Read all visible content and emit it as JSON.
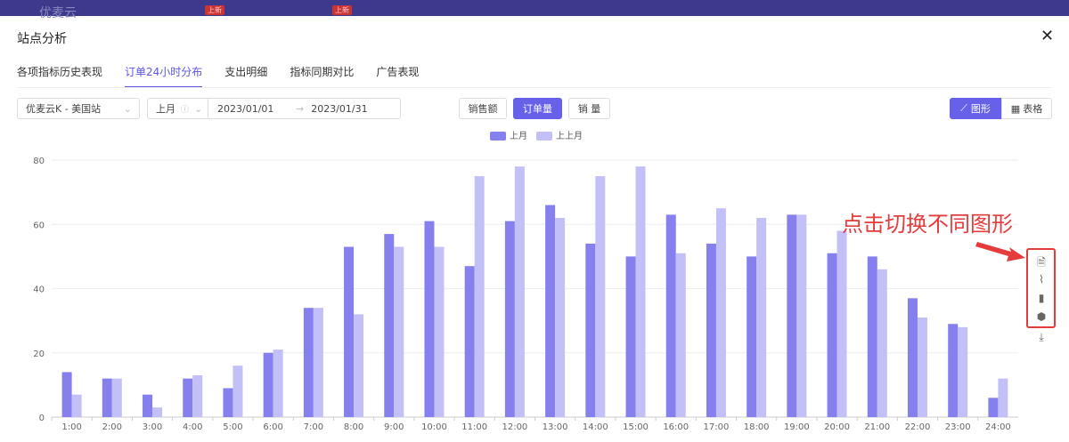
{
  "topbar": {
    "logo": "优麦云",
    "badges": [
      "上新",
      "上新"
    ]
  },
  "modal": {
    "title": "站点分析"
  },
  "tabs": [
    {
      "label": "各项指标历史表现"
    },
    {
      "label": "订单24小时分布",
      "active": true
    },
    {
      "label": "支出明细"
    },
    {
      "label": "指标同期对比"
    },
    {
      "label": "广告表现"
    }
  ],
  "filters": {
    "store": "优麦云K - 美国站",
    "period": "上月",
    "start": "2023/01/01",
    "arrow": "→",
    "end": "2023/01/31"
  },
  "metrics": [
    {
      "label": "销售额"
    },
    {
      "label": "订单量",
      "active": true
    },
    {
      "label": "销 量"
    }
  ],
  "view": {
    "chart_label": "图形",
    "table_label": "表格"
  },
  "annotation": "点击切换不同图形",
  "colors": {
    "accent": "#6760e8",
    "series1": "#8680ee",
    "series2": "#c3c0f8",
    "annotation": "#e53b3b"
  },
  "chart_data": {
    "type": "bar",
    "categories": [
      "1:00",
      "2:00",
      "3:00",
      "4:00",
      "5:00",
      "6:00",
      "7:00",
      "8:00",
      "9:00",
      "10:00",
      "11:00",
      "12:00",
      "13:00",
      "14:00",
      "15:00",
      "16:00",
      "17:00",
      "18:00",
      "19:00",
      "20:00",
      "21:00",
      "22:00",
      "23:00",
      "24:00"
    ],
    "series": [
      {
        "name": "上月",
        "values": [
          14,
          12,
          7,
          12,
          9,
          20,
          34,
          53,
          57,
          61,
          47,
          61,
          66,
          54,
          50,
          63,
          54,
          50,
          63,
          51,
          50,
          37,
          29,
          6
        ]
      },
      {
        "name": "上上月",
        "values": [
          7,
          12,
          3,
          13,
          16,
          21,
          34,
          32,
          53,
          53,
          75,
          78,
          62,
          75,
          78,
          51,
          65,
          62,
          63,
          58,
          46,
          31,
          28,
          12
        ]
      }
    ],
    "yticks": [
      0,
      20,
      40,
      60,
      80
    ],
    "ylim": [
      0,
      80
    ],
    "legend": "top-center",
    "grid": true
  }
}
